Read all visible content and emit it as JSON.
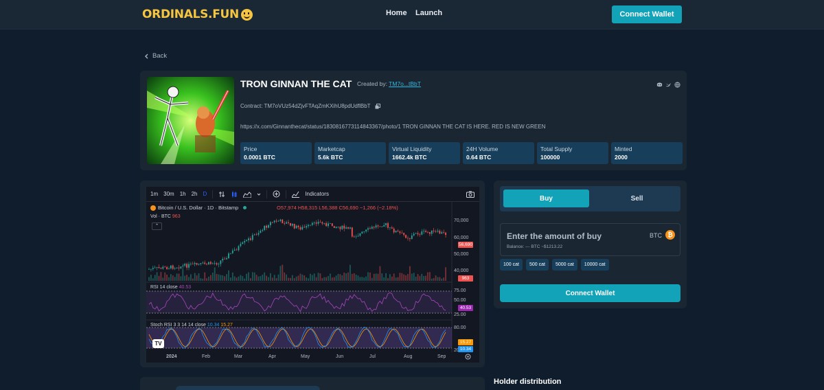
{
  "header": {
    "logo": "ORDINALS.FUN",
    "nav": [
      {
        "label": "Home"
      },
      {
        "label": "Launch"
      }
    ],
    "connect_label": "Connect Wallet"
  },
  "back_label": "Back",
  "token": {
    "name": "TRON GINNAN THE CAT",
    "created_prefix": "Created by:",
    "creator": "TM7o...tBbT",
    "contract": "Contract: TM7oVUz54dZjvFTAqZmKXihU8pdUdflBbT",
    "description": "https://x.com/Ginnanthecat/status/1830816773114843367/photo/1 TRON GINNAN THE CAT IS HERE. RED IS NEW GREEN",
    "stats": [
      {
        "label": "Price",
        "value": "0.0001 BTC"
      },
      {
        "label": "Marketcap",
        "value": "5.6k BTC"
      },
      {
        "label": "Virtual Liquidity",
        "value": "1662.4k BTC"
      },
      {
        "label": "24H Volume",
        "value": "0.64 BTC"
      },
      {
        "label": "Total Supply",
        "value": "100000"
      },
      {
        "label": "Minted",
        "value": "2000"
      }
    ]
  },
  "chart": {
    "intervals": [
      "1m",
      "30m",
      "1h",
      "2h",
      "D"
    ],
    "indicators_label": "Indicators",
    "symbol_title": "Bitcoin / U.S. Dollar · 1D · Bitstamp",
    "ohlc": "O57,974 H58,315 L56,388 C56,690 −1,266 (−2.18%)",
    "vol_label": "Vol · BTC",
    "vol_value": "963",
    "rsi_label": "RSI 14 close",
    "rsi_value": "40.53",
    "stoch_label": "Stoch RSI 3 3 14 14 close",
    "stoch_k": "10.34",
    "stoch_d": "15.27",
    "price_axis": [
      "70,000",
      "60,000",
      "50,000",
      "40,000"
    ],
    "price_tag": "56,690",
    "vol_tag": "963",
    "rsi_axis": [
      "75.00",
      "50.00",
      "25.00"
    ],
    "rsi_tag": "40.53",
    "stoch_axis": [
      "80.00",
      "20.00"
    ],
    "stoch_tags": [
      "15.27",
      "10.34"
    ],
    "x_axis": [
      "2024",
      "Feb",
      "Mar",
      "Apr",
      "May",
      "Jun",
      "Jul",
      "Aug",
      "Sep"
    ],
    "colors": {
      "up": "#26a69a",
      "down": "#ef5350",
      "rsi": "#ab47bc",
      "stoch_k": "#2196f3",
      "stoch_d": "#ff9800"
    }
  },
  "trade": {
    "buy_label": "Buy",
    "sell_label": "Sell",
    "amount_placeholder": "Enter the amount of buy",
    "currency": "BTC",
    "balance": "Balance: --- BTC ~$1213.22",
    "quick_amounts": [
      "100 cat",
      "500 cat",
      "5000 cat",
      "10000 cat"
    ],
    "connect_label": "Connect Wallet"
  },
  "holder_title": "Holder distribution",
  "colors": {
    "accent": "#13a3b8",
    "background": "#0f1d2c",
    "card": "#1a2733",
    "stat_bg": "#173e5a"
  }
}
